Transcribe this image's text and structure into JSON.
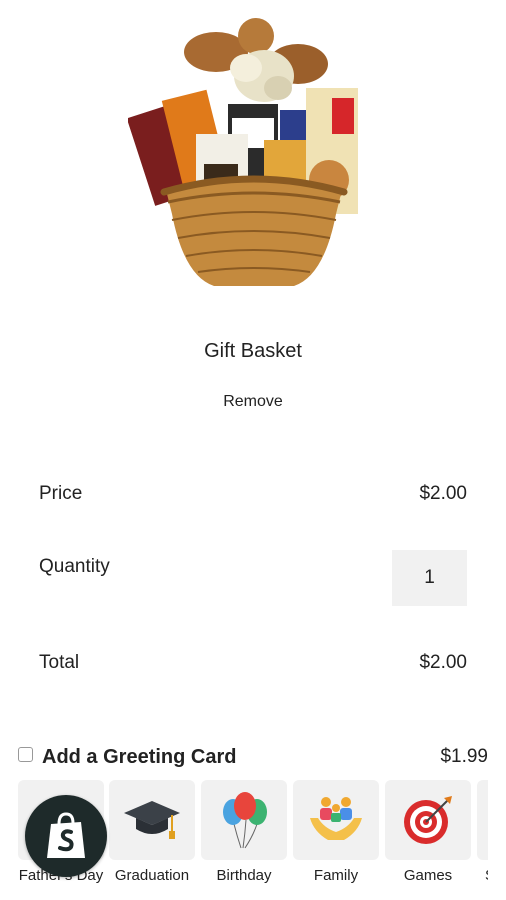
{
  "product": {
    "title": "Gift Basket",
    "remove_label": "Remove",
    "image_icon": "gift-basket-image"
  },
  "summary": {
    "price_label": "Price",
    "price_value": "$2.00",
    "quantity_label": "Quantity",
    "quantity_value": "1",
    "total_label": "Total",
    "total_value": "$2.00"
  },
  "greeting_card": {
    "label": "Add a Greeting Card",
    "price": "$1.99",
    "checked": false
  },
  "card_categories": [
    {
      "label": "Father's Day",
      "icon": "fathers-day-icon"
    },
    {
      "label": "Graduation",
      "icon": "graduation-cap-icon"
    },
    {
      "label": "Birthday",
      "icon": "balloons-icon"
    },
    {
      "label": "Family",
      "icon": "family-icon"
    },
    {
      "label": "Games",
      "icon": "dart-target-icon"
    },
    {
      "label": "S",
      "icon": "partial-card-icon"
    }
  ],
  "badge": {
    "icon": "shopify-bag-icon"
  },
  "colors": {
    "tile_bg": "#f1f1f1",
    "text": "#222222",
    "badge_bg": "#1e2a2a",
    "shopify_green": "#95bf47"
  }
}
